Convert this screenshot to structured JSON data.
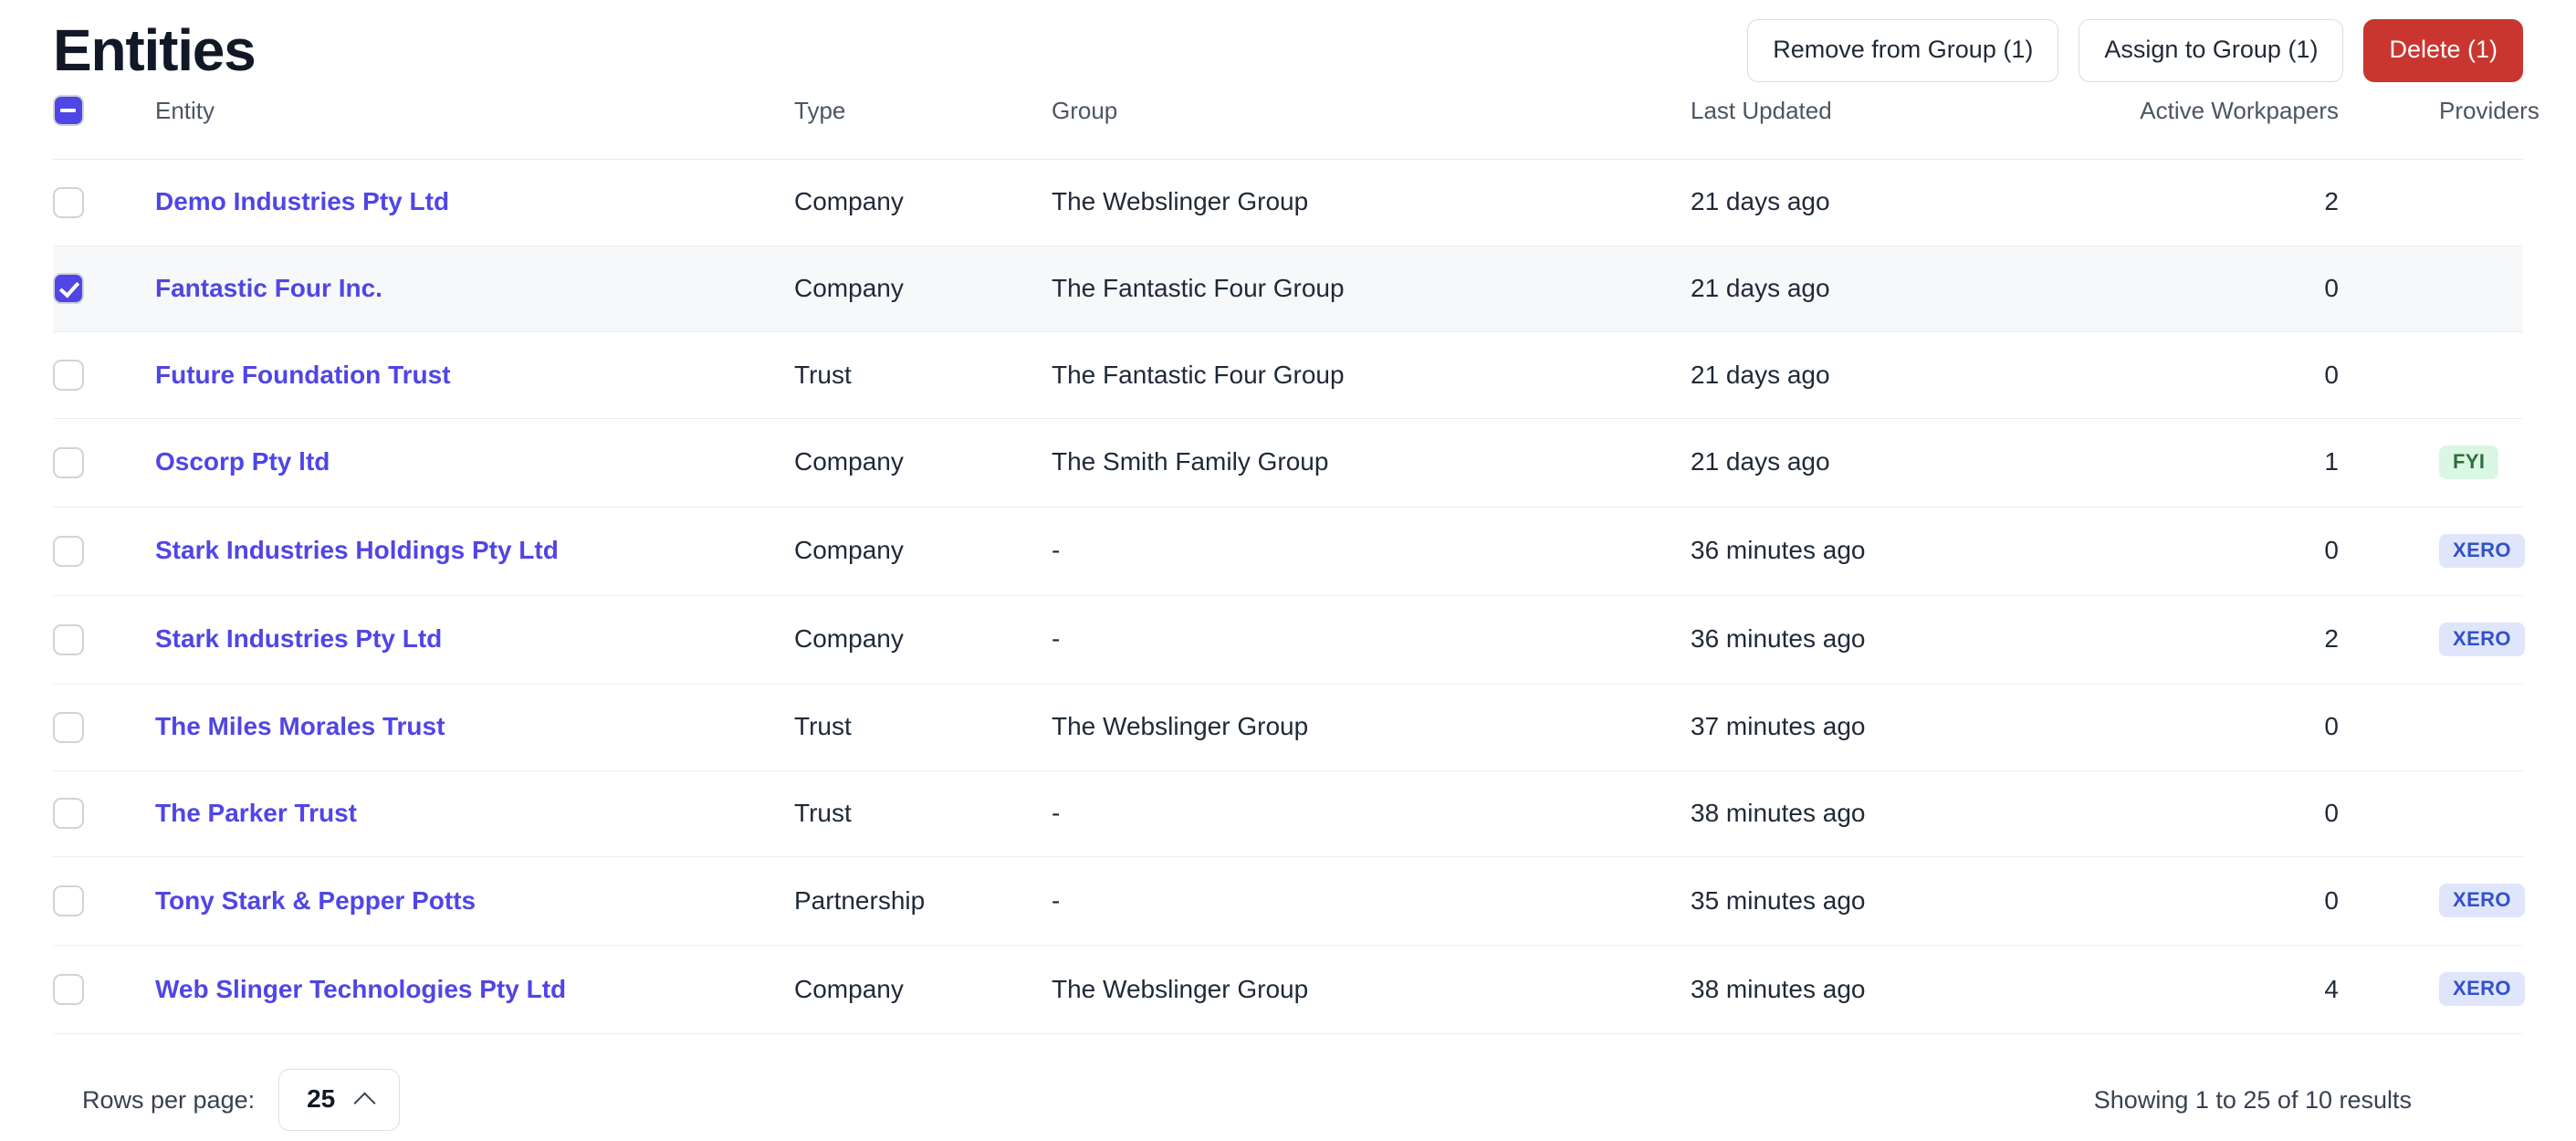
{
  "header": {
    "title": "Entities",
    "actions": [
      {
        "label": "Remove from Group (1)",
        "style": "secondary",
        "name": "remove-from-group-button"
      },
      {
        "label": "Assign to Group (1)",
        "style": "secondary",
        "name": "assign-to-group-button"
      },
      {
        "label": "Delete (1)",
        "style": "danger",
        "name": "delete-button"
      }
    ]
  },
  "table": {
    "select_all_state": "indeterminate",
    "columns": [
      {
        "key": "entity",
        "label": "Entity"
      },
      {
        "key": "type",
        "label": "Type"
      },
      {
        "key": "group",
        "label": "Group"
      },
      {
        "key": "last_updated",
        "label": "Last Updated"
      },
      {
        "key": "active_workpapers",
        "label": "Active Workpapers"
      },
      {
        "key": "providers",
        "label": "Providers"
      }
    ],
    "rows": [
      {
        "selected": false,
        "entity": "Demo Industries Pty Ltd",
        "type": "Company",
        "group": "The Webslinger Group",
        "last_updated": "21 days ago",
        "active_workpapers": "2",
        "providers": []
      },
      {
        "selected": true,
        "entity": "Fantastic Four Inc.",
        "type": "Company",
        "group": "The Fantastic Four Group",
        "last_updated": "21 days ago",
        "active_workpapers": "0",
        "providers": []
      },
      {
        "selected": false,
        "entity": "Future Foundation Trust",
        "type": "Trust",
        "group": "The Fantastic Four Group",
        "last_updated": "21 days ago",
        "active_workpapers": "0",
        "providers": []
      },
      {
        "selected": false,
        "entity": "Oscorp Pty ltd",
        "type": "Company",
        "group": "The Smith Family Group",
        "last_updated": "21 days ago",
        "active_workpapers": "1",
        "providers": [
          {
            "label": "FYI",
            "variant": "fyi"
          }
        ]
      },
      {
        "selected": false,
        "entity": "Stark Industries Holdings Pty Ltd",
        "type": "Company",
        "group": "-",
        "last_updated": "36 minutes ago",
        "active_workpapers": "0",
        "providers": [
          {
            "label": "XERO",
            "variant": "xero"
          }
        ]
      },
      {
        "selected": false,
        "entity": "Stark Industries Pty Ltd",
        "type": "Company",
        "group": "-",
        "last_updated": "36 minutes ago",
        "active_workpapers": "2",
        "providers": [
          {
            "label": "XERO",
            "variant": "xero"
          }
        ]
      },
      {
        "selected": false,
        "entity": "The Miles Morales Trust",
        "type": "Trust",
        "group": "The Webslinger Group",
        "last_updated": "37 minutes ago",
        "active_workpapers": "0",
        "providers": []
      },
      {
        "selected": false,
        "entity": "The Parker Trust",
        "type": "Trust",
        "group": "-",
        "last_updated": "38 minutes ago",
        "active_workpapers": "0",
        "providers": []
      },
      {
        "selected": false,
        "entity": "Tony Stark & Pepper Potts",
        "type": "Partnership",
        "group": "-",
        "last_updated": "35 minutes ago",
        "active_workpapers": "0",
        "providers": [
          {
            "label": "XERO",
            "variant": "xero"
          }
        ]
      },
      {
        "selected": false,
        "entity": "Web Slinger Technologies Pty Ltd",
        "type": "Company",
        "group": "The Webslinger Group",
        "last_updated": "38 minutes ago",
        "active_workpapers": "4",
        "providers": [
          {
            "label": "XERO",
            "variant": "xero"
          }
        ]
      }
    ]
  },
  "footer": {
    "rows_per_page_label": "Rows per page:",
    "rows_per_page_value": "25",
    "rows_per_page_icon": "chevron-up-icon",
    "results_text": "Showing 1 to 25 of 10 results"
  },
  "colors": {
    "link": "#4f46e5",
    "checkbox_accent": "#4f46e5",
    "danger": "#c9362f",
    "badge_xero_bg": "#dfe6fb",
    "badge_xero_fg": "#3351ca",
    "badge_fyi_bg": "#d9f7e2",
    "badge_fyi_fg": "#2f6e3d",
    "selected_row_bg": "#f7f8fa"
  }
}
